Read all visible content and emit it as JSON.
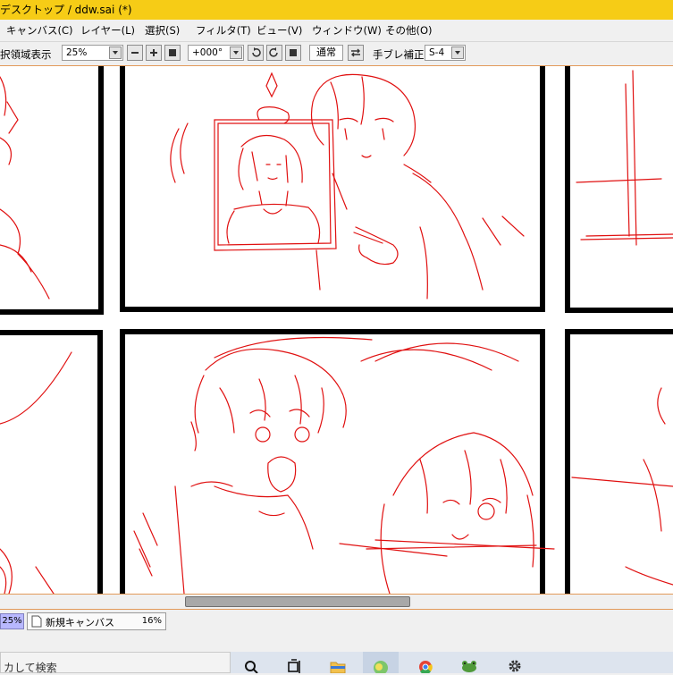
{
  "window": {
    "title": "デスクトップ / ddw.sai (*)"
  },
  "menu": [
    {
      "label": "キャンバス(C)"
    },
    {
      "label": "レイヤー(L)"
    },
    {
      "label": "選択(S)"
    },
    {
      "label": "フィルタ(T)"
    },
    {
      "label": "ビュー(V)"
    },
    {
      "label": "ウィンドウ(W)"
    },
    {
      "label": "その他(O)"
    }
  ],
  "toolbar": {
    "selection_display_label": "択領域表示",
    "zoom_value": "25%",
    "rotation_value": "+000°",
    "blend_mode": "通常",
    "stabilizer_label": "手ブレ補正",
    "stabilizer_value": "S-4"
  },
  "tabs": {
    "zoom_indicator": "25%",
    "documents": [
      {
        "name": "新規キャンバス",
        "zoom": "16%"
      }
    ]
  },
  "taskbar": {
    "search_placeholder": "カして検索",
    "icons": [
      "search-icon",
      "task-view-icon",
      "file-explorer-icon",
      "photo-app-icon",
      "chrome-icon",
      "frog-app-icon",
      "settings-icon"
    ]
  },
  "colors": {
    "title_bar": "#f6cc16",
    "sketch_line": "#e01010",
    "panel_border": "#000000",
    "toolbar_separator": "#e29a5a"
  }
}
